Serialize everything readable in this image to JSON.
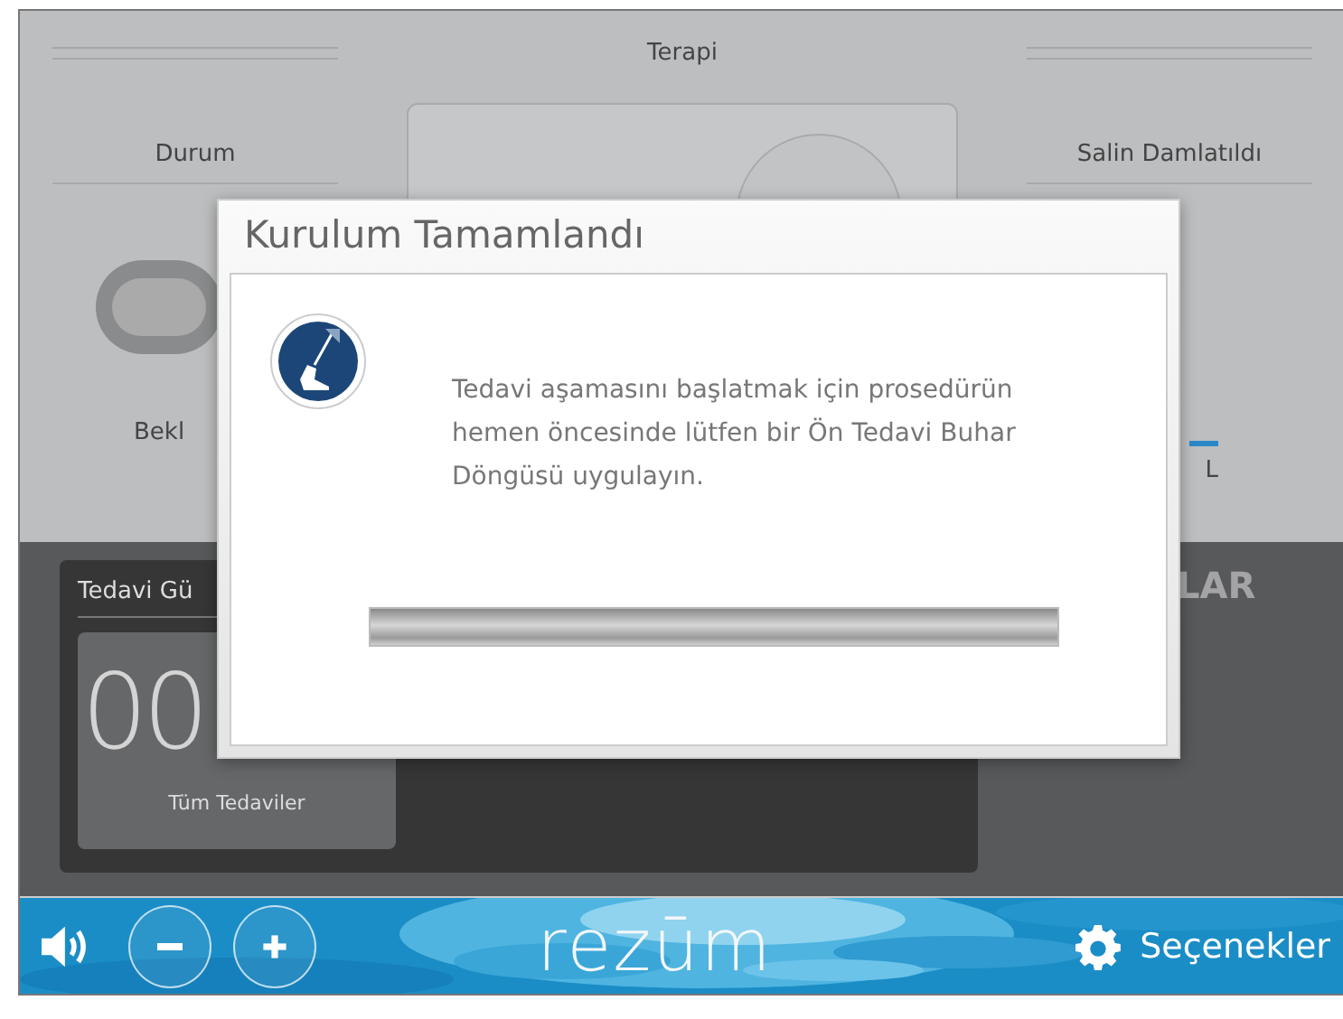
{
  "therapy_header": {
    "title": "Terapi"
  },
  "status_panel": {
    "title": "Durum",
    "toggle_on": false,
    "state_label": "Bekl"
  },
  "saline_panel": {
    "title": "Salin Damlatıldı",
    "unit": "L"
  },
  "treatment_panel": {
    "title": "Tedavi Gü",
    "count": "00",
    "count_label": "Tüm Tedaviler",
    "side_title": "LAR"
  },
  "dialog": {
    "title": "Kurulum Tamamlandı",
    "message": "Tedavi aşamasını başlatmak için prosedürün hemen öncesinde lütfen bir Ön Tedavi Buhar Döngüsü uygulayın.",
    "progress": {
      "level": 1
    }
  },
  "bottom_bar": {
    "logo": "rezūm",
    "buttons": [
      {
        "kind": "volume"
      },
      {
        "kind": "minus"
      },
      {
        "kind": "plus"
      }
    ],
    "options_label": "Seçenekler"
  }
}
